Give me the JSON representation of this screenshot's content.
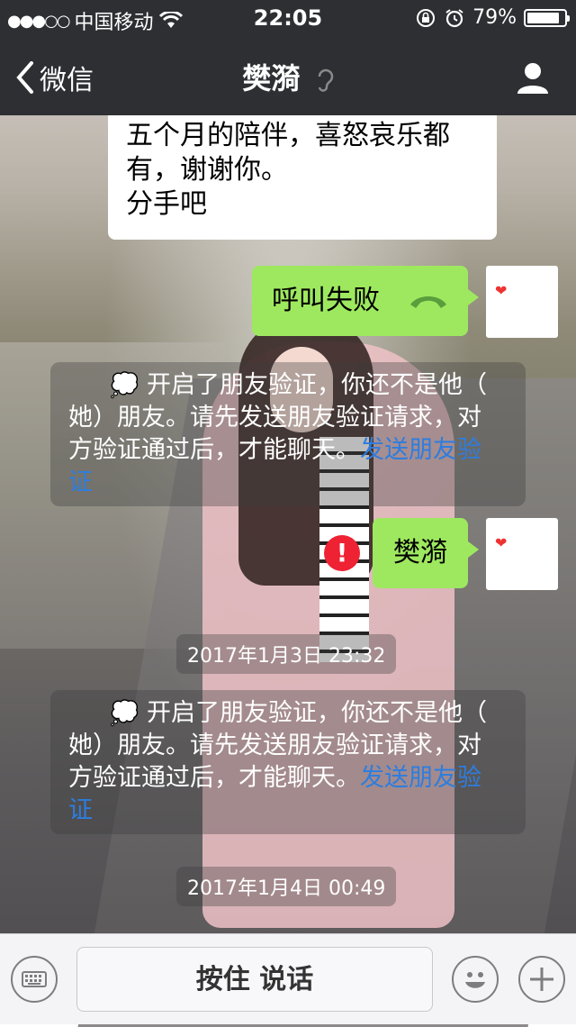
{
  "status_bar": {
    "signal_dots": "●●●○○",
    "carrier": "中国移动",
    "time": "22:05",
    "battery_percent": "79%",
    "battery_level": 0.79
  },
  "nav": {
    "back_label": "微信",
    "title": "樊漪"
  },
  "messages": {
    "received_text": "五个月的陪伴，喜怒哀乐都有，谢谢你。\n分手吧",
    "received_line1": "五个月的陪伴，喜怒哀乐都",
    "received_line2": "有，谢谢你。",
    "received_line3": "分手吧",
    "call_failed": "呼叫失败",
    "sent_text": "樊漪",
    "timestamp1": "2017年1月3日 23:32",
    "timestamp2": "2017年1月4日 00:49"
  },
  "system_notice": {
    "text_l1": "开启了朋友验证，你还不是他（",
    "text_l2": "她）朋友。请先发送朋友验证请求，对",
    "text_l3": "方验证通过后，才能聊天。",
    "link_part1": "发送朋友验",
    "link_part2": "证"
  },
  "input_bar": {
    "hold_to_talk": "按住 说话"
  }
}
